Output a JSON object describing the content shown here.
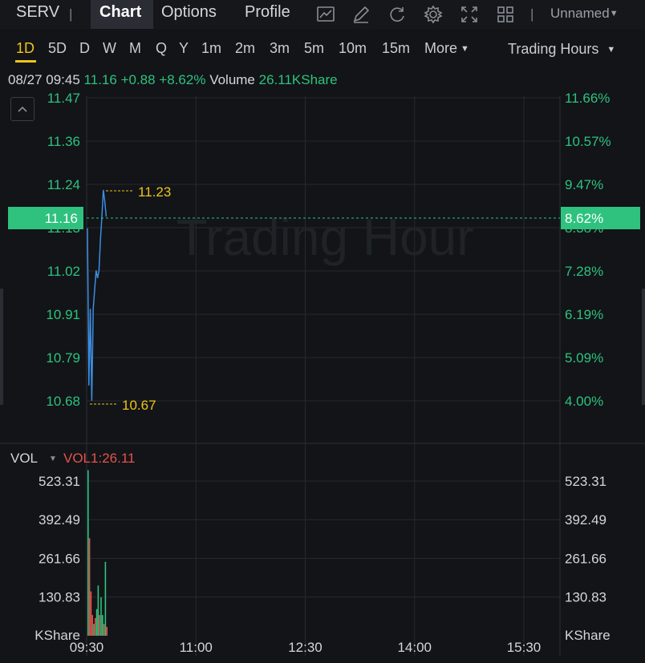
{
  "toolbar": {
    "symbol": "SERV",
    "tabs": [
      "Chart",
      "Options",
      "Profile"
    ],
    "active_tab": "Chart",
    "icons": [
      "indicator-icon",
      "draw-icon",
      "refresh-icon",
      "settings-icon",
      "fullscreen-icon",
      "layout-icon"
    ],
    "layout_name": "Unnamed"
  },
  "intervals": {
    "items": [
      "1D",
      "5D",
      "D",
      "W",
      "M",
      "Q",
      "Y",
      "1m",
      "2m",
      "3m",
      "5m",
      "10m",
      "15m",
      "More"
    ],
    "active": "1D",
    "session": "Trading Hours"
  },
  "quote": {
    "datetime": "08/27 09:45",
    "price": "11.16",
    "change": "+0.88",
    "change_pct": "+8.62%",
    "volume_label": "Volume",
    "volume": "26.11KShare"
  },
  "watermark": "Trading Hour",
  "colors": {
    "up": "#2ec27e",
    "down": "#e5534b",
    "line": "#3d8de0",
    "marker": "#f0c419",
    "vol_label": "#e5534b"
  },
  "price_axis": {
    "left_ticks": [
      "11.47",
      "11.36",
      "11.24",
      "11.13",
      "11.02",
      "10.91",
      "10.79",
      "10.68"
    ],
    "right_ticks": [
      "11.66%",
      "10.57%",
      "9.47%",
      "8.38%",
      "7.28%",
      "6.19%",
      "5.09%",
      "4.00%"
    ],
    "last_price_tag": "11.16",
    "last_pct_tag": "8.62%",
    "high_label": "11.23",
    "low_label": "10.67"
  },
  "volume_panel": {
    "title": "VOL",
    "indicator": "VOL1:26.11",
    "ticks": [
      "523.31",
      "392.49",
      "261.66",
      "130.83"
    ],
    "unit": "KShare"
  },
  "time_axis": [
    "09:30",
    "11:00",
    "12:30",
    "14:00",
    "15:30"
  ],
  "chart_data": {
    "type": "line",
    "series": [
      {
        "values": [
          11.13,
          10.72,
          10.92,
          10.68,
          10.92,
          10.97,
          11.02,
          11.0,
          11.02,
          11.1,
          11.16,
          11.23,
          11.2,
          11.16
        ]
      }
    ],
    "ylim": [
      10.68,
      11.47
    ],
    "volume": {
      "unit": "KShare",
      "ylim": [
        0,
        523.31
      ],
      "bars": [
        {
          "v": 560,
          "up": true
        },
        {
          "v": 330,
          "up": false
        },
        {
          "v": 150,
          "up": false
        },
        {
          "v": 70,
          "up": false
        },
        {
          "v": 40,
          "up": true
        },
        {
          "v": 60,
          "up": false
        },
        {
          "v": 90,
          "up": true
        },
        {
          "v": 170,
          "up": true
        },
        {
          "v": 70,
          "up": false
        },
        {
          "v": 130,
          "up": true
        },
        {
          "v": 70,
          "up": true
        },
        {
          "v": 40,
          "up": false
        },
        {
          "v": 250,
          "up": true
        },
        {
          "v": 30,
          "up": false
        }
      ]
    }
  }
}
